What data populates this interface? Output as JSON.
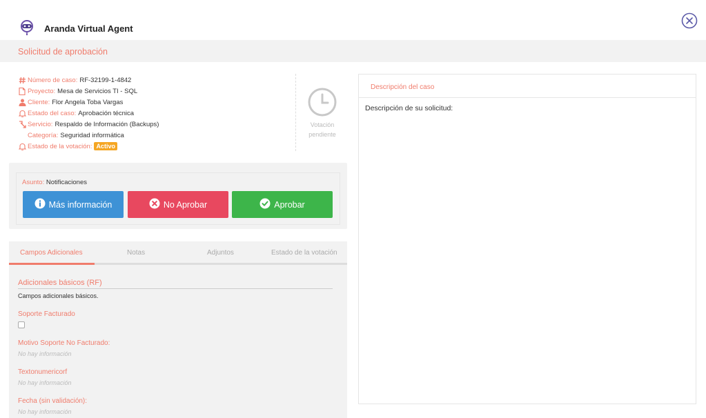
{
  "app": {
    "title": "Aranda Virtual Agent"
  },
  "header": {
    "section_title": "Solicitud de aprobación"
  },
  "case_info": {
    "case_number_label": "Número de caso:",
    "case_number": "RF-32199-1-4842",
    "project_label": "Proyecto:",
    "project": "Mesa de Servicios TI - SQL",
    "client_label": "Cliente:",
    "client": "Flor Angela Toba Vargas",
    "case_status_label": "Estado del caso:",
    "case_status": "Aprobación técnica",
    "service_label": "Servicio:",
    "service": "Respaldo de Información (Backups)",
    "category_label": "Categoría:",
    "category": "Seguridad informática",
    "vote_status_label": "Estado de la votación:",
    "vote_status": "Activo"
  },
  "vote_pending": {
    "line1": "Votación",
    "line2": "pendiente"
  },
  "actions": {
    "subject_label": "Asunto:",
    "subject": "Notificaciones",
    "more_info_label": "Más información",
    "reject_label": "No Aprobar",
    "approve_label": "Aprobar"
  },
  "tabs": [
    {
      "label": "Campos Adicionales",
      "active": true
    },
    {
      "label": "Notas",
      "active": false
    },
    {
      "label": "Adjuntos",
      "active": false
    },
    {
      "label": "Estado de la votación",
      "active": false
    }
  ],
  "additional_fields": {
    "section_title": "Adicionales básicos (RF)",
    "section_desc": "Campos adicionales básicos.",
    "soporte_facturado_label": "Soporte Facturado",
    "soporte_facturado_checked": false,
    "motivo_label": "Motivo Soporte No Facturado:",
    "motivo_value": "No hay información",
    "textonumericorf_label": "Textonumericorf",
    "textonumericorf_value": "No hay información",
    "fecha_label": "Fecha (sin validación):",
    "fecha_value": "No hay información"
  },
  "description": {
    "title": "Descripción del caso",
    "body": "Descripción de su solicitud:"
  },
  "colors": {
    "accent": "#f07c6c",
    "info_button": "#3e92d6",
    "reject_button": "#e8485f",
    "approve_button": "#3db54a",
    "badge": "#f5a623",
    "close_icon": "#5b5aa8"
  },
  "icons": {
    "logo": "aranda-logo-icon",
    "close": "close-circle-icon",
    "case_number": "hash-icon",
    "project": "document-icon",
    "client": "person-icon",
    "case_status": "bell-icon",
    "service": "service-icon",
    "vote_status": "bell-icon",
    "vote_pending": "clock-icon",
    "more_info": "info-circle-icon",
    "reject": "x-circle-icon",
    "approve": "check-circle-icon"
  }
}
